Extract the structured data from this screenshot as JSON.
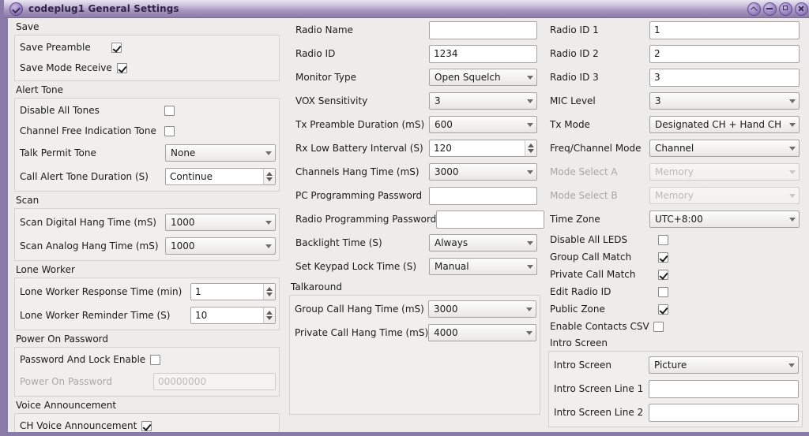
{
  "window": {
    "title": "codeplug1 General Settings",
    "icon": "menu-chevron-icon",
    "buttons": [
      {
        "name": "rollup-button",
        "label": "Roll Up"
      },
      {
        "name": "minimize-button",
        "label": "Minimize"
      },
      {
        "name": "maximize-button",
        "label": "Maximize"
      },
      {
        "name": "close-button",
        "label": "Close"
      }
    ]
  },
  "left": {
    "save": {
      "title": "Save",
      "save_preamble_label": "Save Preamble",
      "save_preamble_checked": true,
      "save_mode_receive_label": "Save Mode Receive",
      "save_mode_receive_checked": true
    },
    "alert_tone": {
      "title": "Alert Tone",
      "disable_all_tones_label": "Disable All Tones",
      "disable_all_tones_checked": false,
      "channel_free_label": "Channel Free Indication Tone",
      "channel_free_checked": false,
      "talk_permit_label": "Talk Permit Tone",
      "talk_permit_value": "None",
      "call_alert_label": "Call Alert Tone Duration (S)",
      "call_alert_value": "Continue"
    },
    "scan": {
      "title": "Scan",
      "digital_label": "Scan Digital Hang Time (mS)",
      "digital_value": "1000",
      "analog_label": "Scan Analog Hang Time (mS)",
      "analog_value": "1000"
    },
    "lone_worker": {
      "title": "Lone Worker",
      "response_label": "Lone Worker Response Time (min)",
      "response_value": "1",
      "reminder_label": "Lone Worker Reminder Time (S)",
      "reminder_value": "10"
    },
    "power_on_password": {
      "title": "Power On Password",
      "enable_label": "Password And Lock Enable",
      "enable_checked": false,
      "password_label": "Power On Password",
      "password_placeholder": "00000000",
      "password_value": ""
    },
    "voice": {
      "title": "Voice Announcement",
      "ch_voice_label": "CH Voice Announcement",
      "ch_voice_checked": true
    }
  },
  "mid": {
    "radio_name_label": "Radio Name",
    "radio_name_value": "",
    "radio_id_label": "Radio ID",
    "radio_id_value": "1234",
    "monitor_type_label": "Monitor Type",
    "monitor_type_value": "Open Squelch",
    "vox_label": "VOX Sensitivity",
    "vox_value": "3",
    "tx_preamble_label": "Tx Preamble Duration (mS)",
    "tx_preamble_value": "600",
    "rx_low_battery_label": "Rx Low Battery Interval (S)",
    "rx_low_battery_value": "120",
    "channels_hang_label": "Channels Hang Time (mS)",
    "channels_hang_value": "3000",
    "pc_password_label": "PC Programming Password",
    "pc_password_value": "",
    "radio_password_label": "Radio Programming Password",
    "radio_password_value": "",
    "backlight_label": "Backlight Time (S)",
    "backlight_value": "Always",
    "keypad_lock_label": "Set Keypad Lock Time (S)",
    "keypad_lock_value": "Manual",
    "talkaround": {
      "title": "Talkaround",
      "group_call_label": "Group Call Hang Time (mS)",
      "group_call_value": "3000",
      "private_call_label": "Private Call Hang Time (mS)",
      "private_call_value": "4000"
    }
  },
  "right": {
    "radio_id_1_label": "Radio ID 1",
    "radio_id_1_value": "1",
    "radio_id_2_label": "Radio ID 2",
    "radio_id_2_value": "2",
    "radio_id_3_label": "Radio ID 3",
    "radio_id_3_value": "3",
    "mic_level_label": "MIC Level",
    "mic_level_value": "3",
    "tx_mode_label": "Tx Mode",
    "tx_mode_value": "Designated CH + Hand CH",
    "freq_channel_label": "Freq/Channel Mode",
    "freq_channel_value": "Channel",
    "mode_select_a_label": "Mode Select A",
    "mode_select_a_value": "Memory",
    "mode_select_b_label": "Mode Select B",
    "mode_select_b_value": "Memory",
    "time_zone_label": "Time Zone",
    "time_zone_value": "UTC+8:00",
    "disable_leds_label": "Disable All LEDS",
    "disable_leds_checked": false,
    "group_call_match_label": "Group Call Match",
    "group_call_match_checked": true,
    "private_call_match_label": "Private Call Match",
    "private_call_match_checked": true,
    "edit_radio_id_label": "Edit Radio ID",
    "edit_radio_id_checked": false,
    "public_zone_label": "Public Zone",
    "public_zone_checked": true,
    "enable_contacts_csv_label": "Enable Contacts CSV",
    "enable_contacts_csv_checked": false,
    "intro": {
      "title": "Intro Screen",
      "intro_screen_label": "Intro Screen",
      "intro_screen_value": "Picture",
      "line1_label": "Intro Screen Line 1",
      "line1_value": "",
      "line2_label": "Intro Screen Line 2",
      "line2_value": ""
    }
  },
  "colors": {
    "frame": "#8a7aa8",
    "client_bg": "#edecea",
    "groupbox_bg": "#f0efed",
    "groupbox_border": "#d3d1cf",
    "text": "#1b1b1b",
    "disabled_text": "#bdbbb9"
  }
}
